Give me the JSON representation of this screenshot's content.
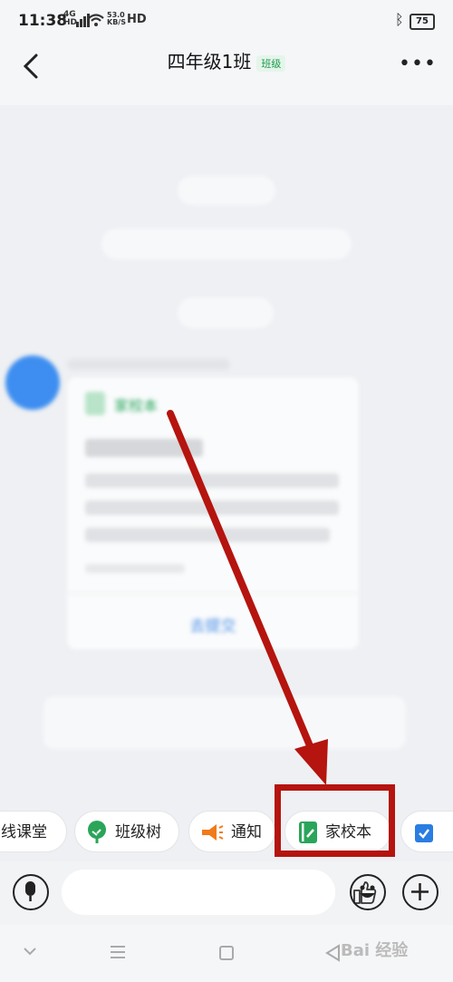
{
  "status_bar": {
    "time": "11:38",
    "network_top": "4G",
    "network_bottom": "HD",
    "speed_value": "53.0",
    "speed_unit": "KB/S",
    "hd": "HD",
    "battery": "75",
    "icons": [
      "signal-icon",
      "wifi-icon",
      "bluetooth-icon",
      "battery-icon"
    ]
  },
  "header": {
    "title": "四年级1班",
    "badge": "班级",
    "subtitle": "",
    "back_icon": "chevron-left-icon",
    "more_icon": "more-dots-icon"
  },
  "chat": {
    "blurred": true,
    "card_app": "家校本",
    "card_button": "去提交"
  },
  "shortcuts": [
    {
      "label": "线课堂",
      "icon": "none"
    },
    {
      "label": "班级树",
      "icon": "tree-icon"
    },
    {
      "label": "通知",
      "icon": "megaphone-icon"
    },
    {
      "label": "家校本",
      "icon": "notebook-icon"
    },
    {
      "label": "",
      "icon": "checklist-icon"
    }
  ],
  "input_bar": {
    "voice_icon": "microphone-icon",
    "like_icon": "thumbs-up-icon",
    "emoji_icon": "emoji-icon",
    "add_icon": "plus-icon",
    "value": ""
  },
  "nav_bar": {
    "icons": [
      "chevron-down-icon",
      "menu-icon",
      "home-square-icon",
      "back-triangle-icon"
    ]
  },
  "watermark": "Bai 经验",
  "colors": {
    "annotation_red": "#b5140f",
    "brand_green": "#26a65b",
    "link_blue": "#4a8ee6",
    "notify_orange": "#f07b1a"
  }
}
